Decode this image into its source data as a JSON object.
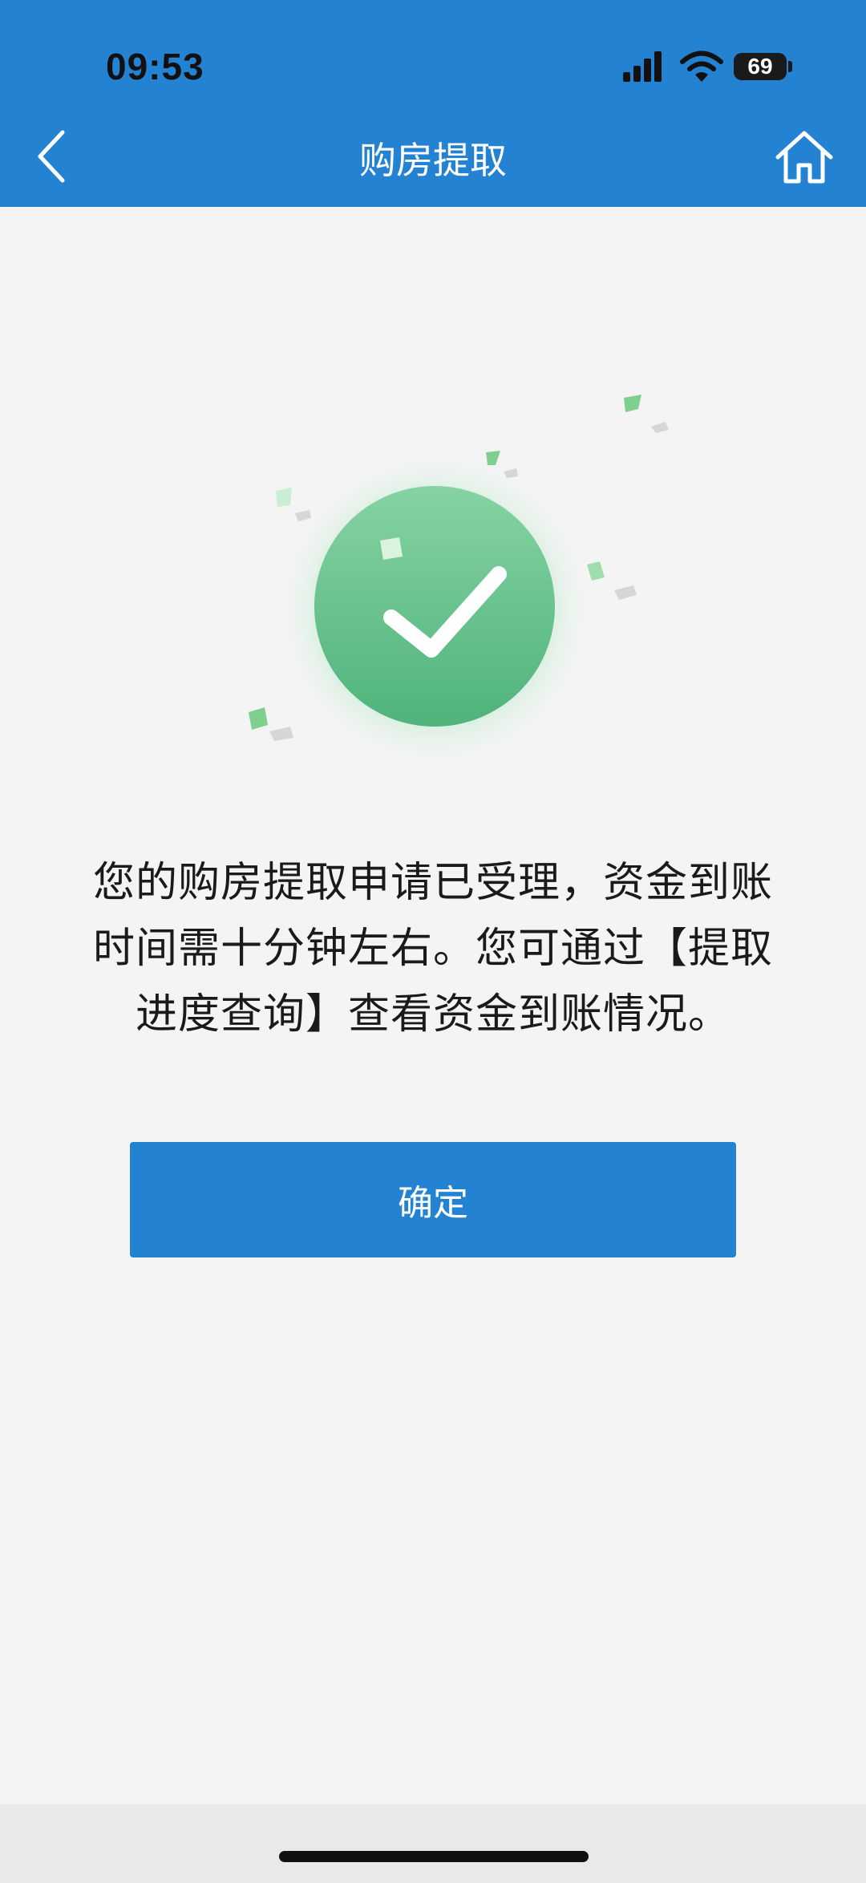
{
  "status_bar": {
    "time": "09:53",
    "battery": "69",
    "icons": [
      "cellular-signal-icon",
      "wifi-icon",
      "battery-icon"
    ]
  },
  "nav": {
    "title": "购房提取",
    "back_icon": "chevron-left-icon",
    "home_icon": "home-icon"
  },
  "success": {
    "icon": "checkmark-icon",
    "message_lines": [
      "您的购房提取申请已受理，资金到账",
      "时间需十分钟左右。您可通过【提取",
      "进度查询】查看资金到账情况。"
    ]
  },
  "confirm_button": {
    "label": "确定"
  },
  "colors": {
    "primary": "#2383d2",
    "success_green": "#5cc38a",
    "background": "#f4f4f4"
  }
}
